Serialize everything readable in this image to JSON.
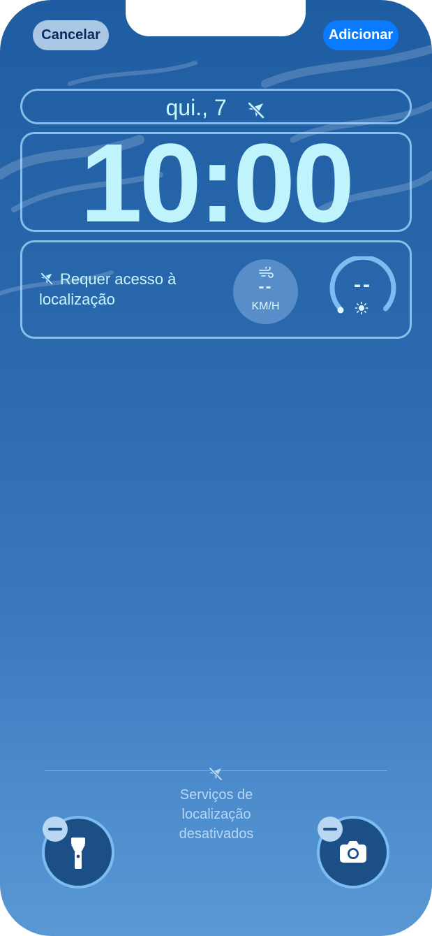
{
  "toolbar": {
    "cancel_label": "Cancelar",
    "add_label": "Adicionar"
  },
  "lockscreen": {
    "date": "qui., 7",
    "time": "10:00"
  },
  "weather_widget": {
    "message": "Requer acesso à localização",
    "wind_value": "--",
    "wind_unit": "KM/H",
    "uv_value": "--"
  },
  "footer": {
    "location_services_text": "Serviços de localização desativados"
  },
  "icons": {
    "location_off": "location-slash-icon",
    "wind": "wind-icon",
    "sun": "sun-icon",
    "flashlight": "flashlight-icon",
    "camera": "camera-icon",
    "minus": "minus-icon"
  },
  "colors": {
    "accent": "#0a7bff",
    "text_glow": "#c8f6ff",
    "frame": "#aadcff"
  }
}
